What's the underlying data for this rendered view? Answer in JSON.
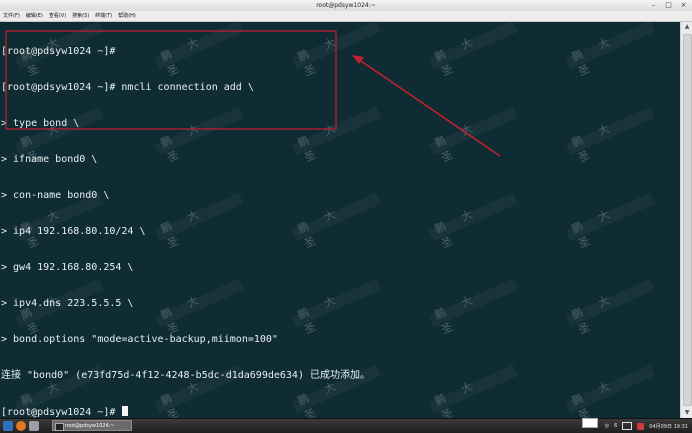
{
  "window": {
    "title": "root@pdsyw1024:~",
    "buttons": [
      "–",
      "□",
      "×"
    ]
  },
  "menu": [
    "文件(F)",
    "编辑(E)",
    "查看(V)",
    "搜索(S)",
    "终端(T)",
    "帮助(H)"
  ],
  "terminal": {
    "lines": [
      "[root@pdsyw1024 ~]#",
      "[root@pdsyw1024 ~]# nmcli connection add \\",
      "> type bond \\",
      "> ifname bond0 \\",
      "> con-name bond0 \\",
      "> ip4 192.168.80.10/24 \\",
      "> gw4 192.168.80.254 \\",
      "> ipv4.dns 223.5.5.5 \\",
      "> bond.options \"mode=active-backup,miimon=100\"",
      "连接 \"bond0\" (e73fd75d-4f12-4248-b5dc-d1da699de634) 已成功添加。",
      "[root@pdsyw1024 ~]# "
    ]
  },
  "watermark": {
    "text": [
      "鹏",
      "大",
      "圣"
    ]
  },
  "annotation": {
    "color": "#c0222d"
  },
  "taskbar": {
    "window_label": "root@pdsyw1024:~",
    "clock": "04月09日 19:31",
    "tray_text": "6"
  }
}
